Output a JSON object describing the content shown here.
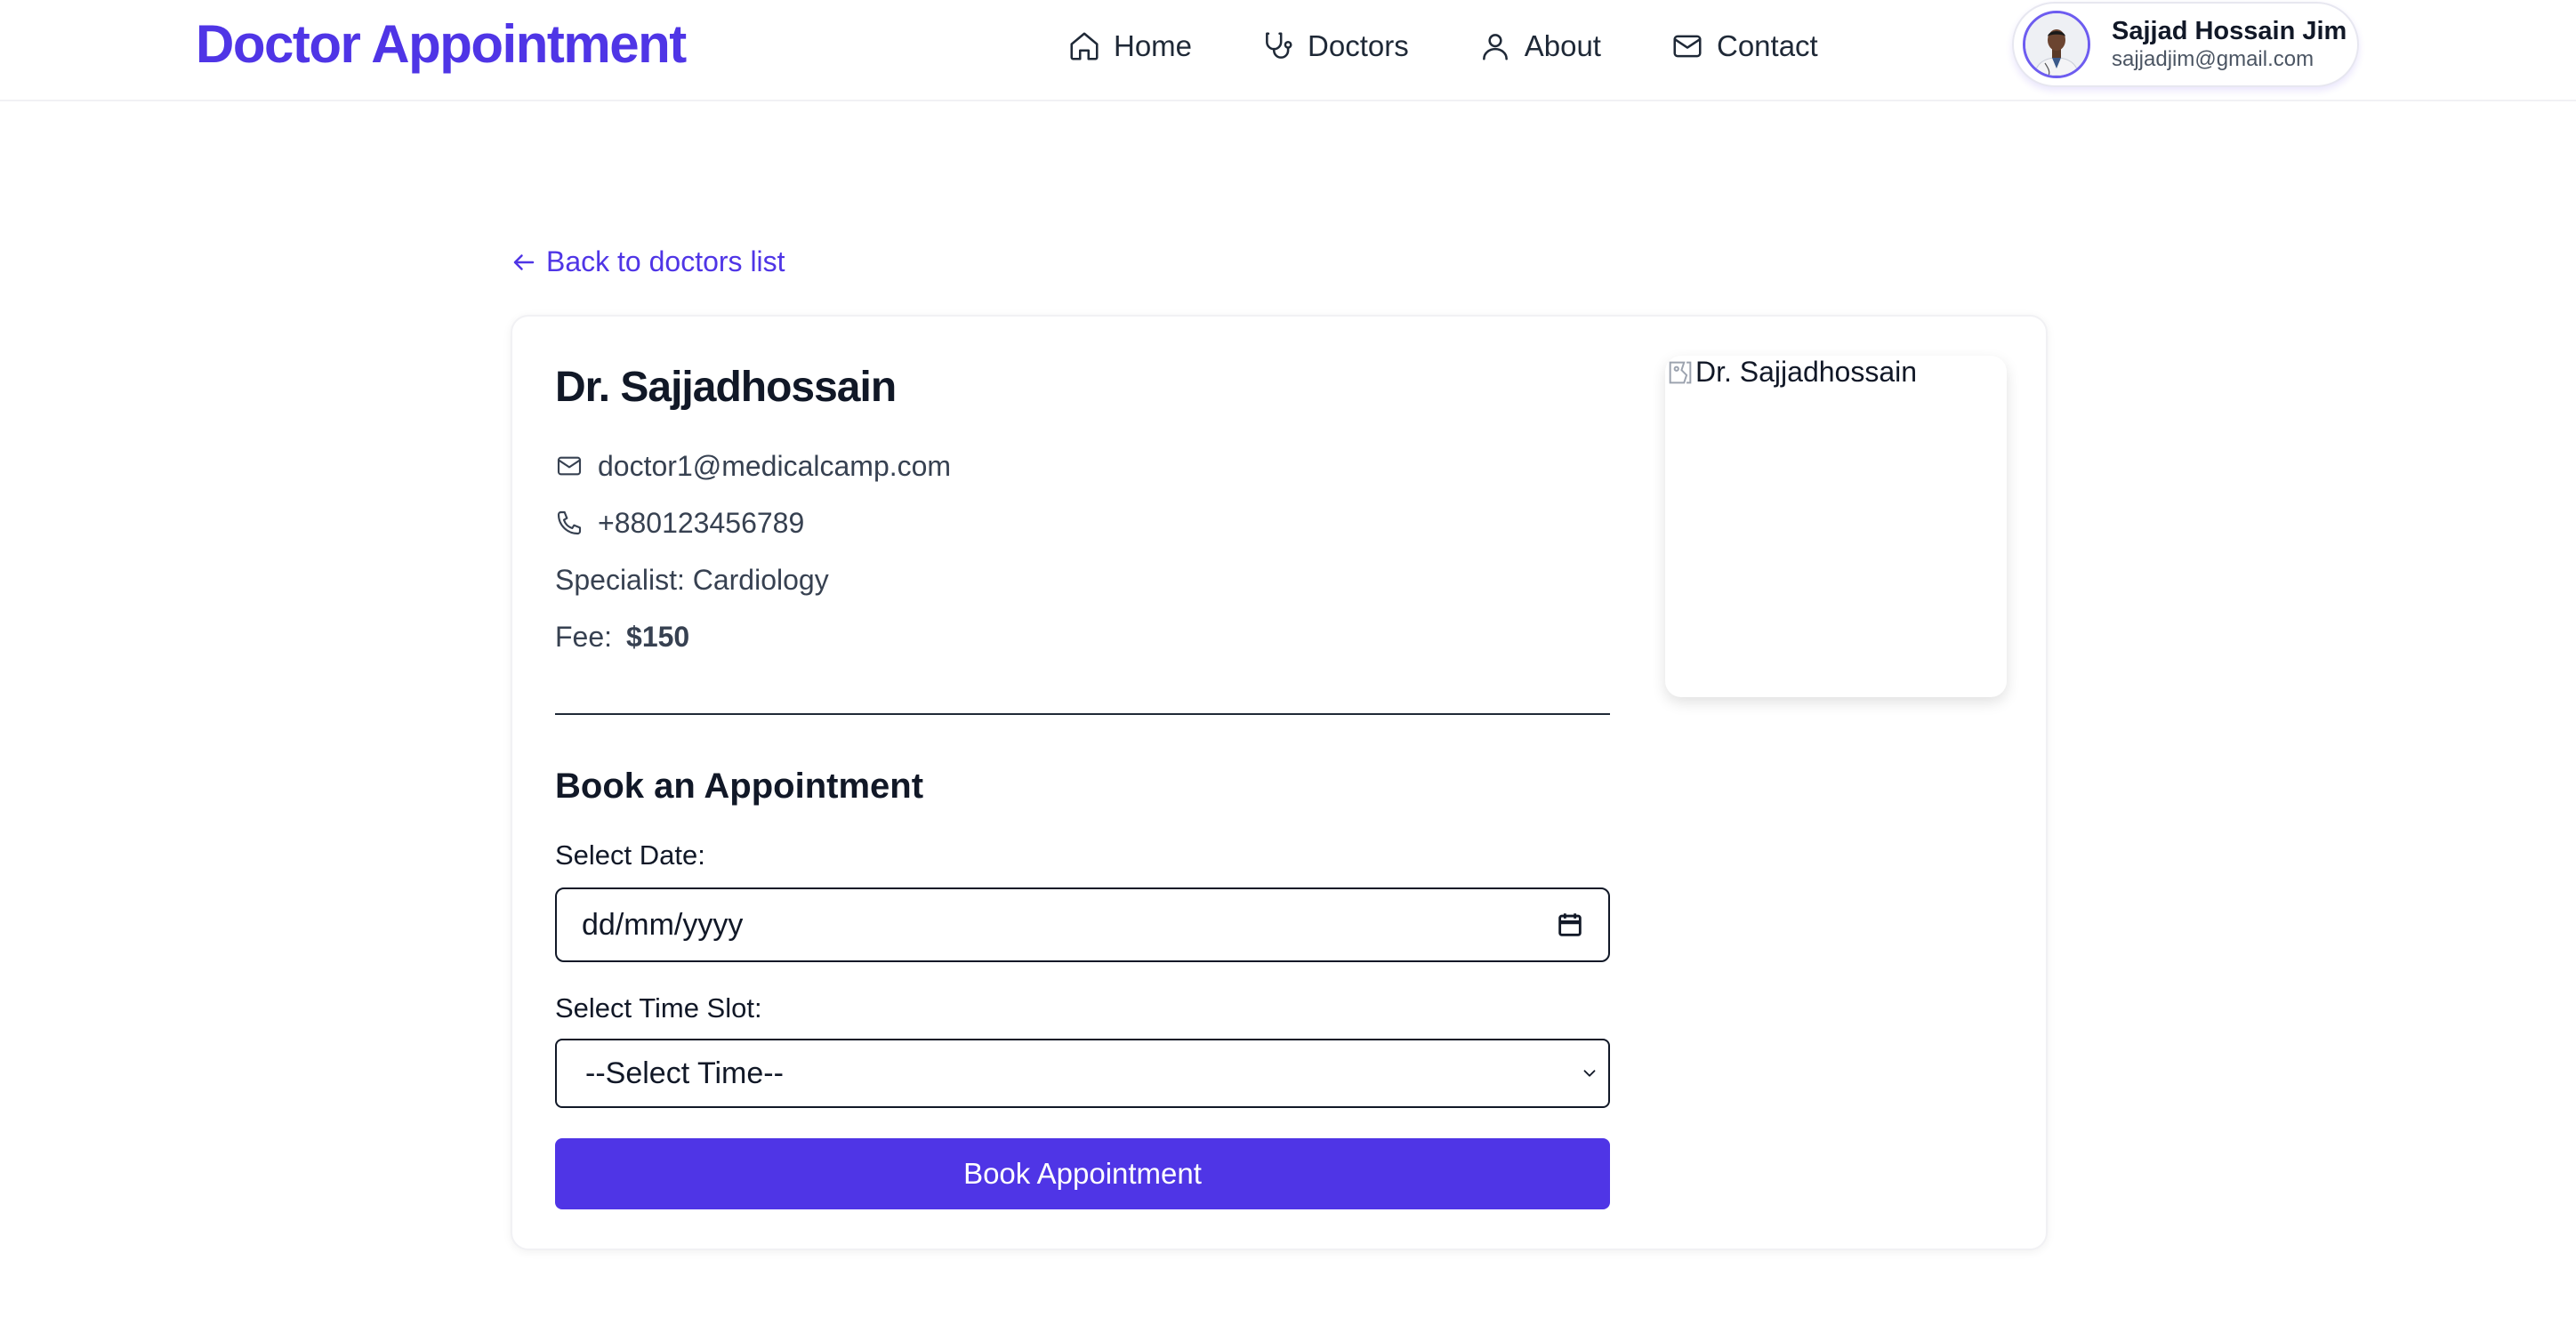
{
  "brand": "Doctor Appointment",
  "nav": {
    "items": [
      {
        "label": "Home",
        "icon": "home-icon"
      },
      {
        "label": "Doctors",
        "icon": "stethoscope-icon"
      },
      {
        "label": "About",
        "icon": "user-icon"
      },
      {
        "label": "Contact",
        "icon": "mail-icon"
      }
    ]
  },
  "user": {
    "name": "Sajjad Hossain Jim",
    "email": "sajjadjim@gmail.com"
  },
  "back_link": "Back to doctors list",
  "doctor": {
    "name": "Dr. Sajjadhossain",
    "email": "doctor1@medicalcamp.com",
    "phone": "+880123456789",
    "specialist": "Specialist: Cardiology",
    "fee_label": "Fee:",
    "fee_value": "$150",
    "image_alt": "Dr. Sajjadhossain"
  },
  "booking": {
    "title": "Book an Appointment",
    "date_label": "Select Date:",
    "date_placeholder": "dd/mm/yyyy",
    "time_label": "Select Time Slot:",
    "time_selected": "--Select Time--",
    "button": "Book Appointment"
  },
  "colors": {
    "accent": "#4f35e6",
    "text": "#111827"
  }
}
